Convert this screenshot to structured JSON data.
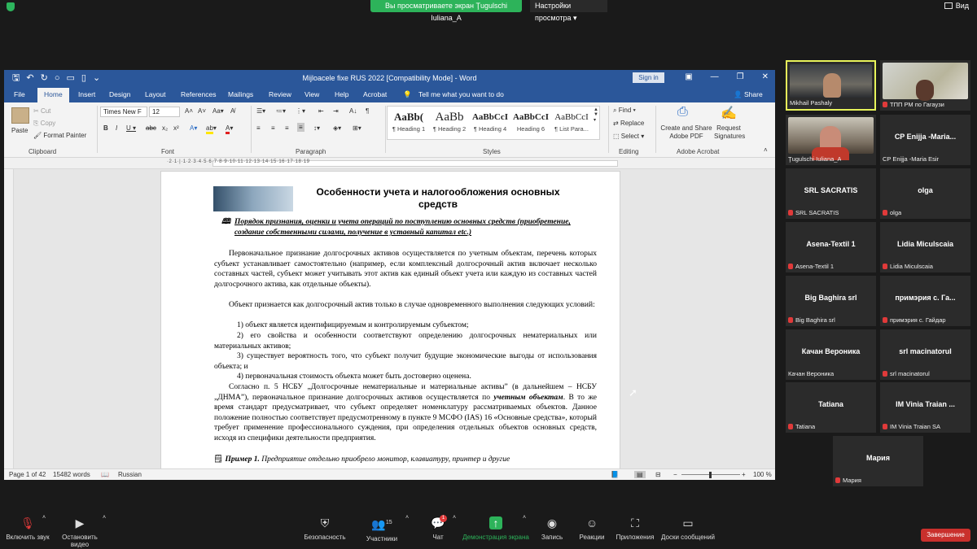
{
  "zoom_top": {
    "share_banner": "Вы просматриваете экран Ţugulschi Iuliana_A",
    "view_settings": "Настройки просмотра",
    "view_button": "Вид"
  },
  "word": {
    "window_title": "Mijloacele fixe RUS 2022 [Compatibility Mode] - Word",
    "sign_in": "Sign in",
    "tabs": [
      "File",
      "Home",
      "Insert",
      "Design",
      "Layout",
      "References",
      "Mailings",
      "Review",
      "View",
      "Help",
      "Acrobat"
    ],
    "tell_me": "Tell me what you want to do",
    "share": "Share",
    "ribbon": {
      "paste": "Paste",
      "cut": "Cut",
      "copy": "Copy",
      "format_painter": "Format Painter",
      "clipboard_label": "Clipboard",
      "font_name": "Times New F",
      "font_size": "12",
      "font_label": "Font",
      "paragraph_label": "Paragraph",
      "styles": [
        {
          "preview": "AaBb(",
          "name": "¶ Heading 1"
        },
        {
          "preview": "AaBb",
          "name": "¶ Heading 2"
        },
        {
          "preview": "AaBbCcI",
          "name": "¶ Heading 4"
        },
        {
          "preview": "AaBbCcI",
          "name": "Heading 6"
        },
        {
          "preview": "AaBbCcI",
          "name": "¶ List Para..."
        }
      ],
      "styles_label": "Styles",
      "find": "Find",
      "replace": "Replace",
      "select": "Select",
      "editing_label": "Editing",
      "create_pdf": "Create and Share Adobe PDF",
      "request_sig": "Request Signatures",
      "acrobat_label": "Adobe Acrobat"
    },
    "document": {
      "heading": "Особенности учета и налогообложения основных средств",
      "subheading": "Порядок признания, оценки и учета операций по поступлению основных средств (приобретение, создание собственными силами, получение в уставный капитал etc.)",
      "para1": "Первоначальное признание долгосрочных активов осуществляется по учетным объектам, перечень которых субъект устанавливает самостоятельно (например, если комплексный долгосрочный актив включает несколько составных частей, субъект может учитывать этот актив как единый объект учета или каждую из составных частей долгосрочного актива, как отдельные объекты).",
      "para2": "Объект признается как долгосрочный актив только в случае одновременного выполнения следующих условий:",
      "item1": "1)  объект является идентифицируемым и контролируемым субъектом;",
      "item2": "2)  его свойства и особенности соответствуют определению долгосрочных нематериальных или материальных активов;",
      "item3": "3)  существует вероятность того, что субъект получит будущие экономические выгоды от использования объекта; и",
      "item4": "4)  первоначальная стоимость объекта может быть достоверно оценена.",
      "para3a": "Согласно п. 5 НСБУ „Долгосрочные нематериальные и материальные активы” (в дальнейшем – НСБУ „ДНМА”), первоначальное признание долгосрочных активов осуществляется по ",
      "para3b": "учетным объектам",
      "para3c": ". В то же время стандарт предусматривает, что субъект определяет номенклатуру рассматриваемых объектов. Данное положение полностью соответствует предусмотренному в пункте 9 МСФО (IAS) 16 «Основные средства», который требует применение профессионального суждения, при определения отдельных объектов основных средств, исходя из специфики деятельности предприятия.",
      "example_label": "Пример 1.",
      "example_text": " Предприятие отдельно приобрело монитор, клавиатуру, принтер и другие"
    },
    "status": {
      "page": "Page 1 of 42",
      "words": "15482 words",
      "language": "Russian",
      "zoom": "100 %"
    }
  },
  "participants": [
    {
      "name": "Mikhail Pashaly",
      "label": "Mikhail Pashaly",
      "video": true,
      "active": true
    },
    {
      "name": "ТПП РМ по Гагаузии",
      "label": "ТПП РМ по Гагаузи",
      "video": true
    },
    {
      "name": "Ţugulschi Iuliana_A",
      "label": "Ţugulschi Iuliana_A",
      "video": true
    },
    {
      "name": "CP Enijja -Maria Esir",
      "label": "CP Enijja -Maria...",
      "foot": "CP Enijja -Maria Esir"
    },
    {
      "label": "SRL SACRATIS",
      "foot": "SRL SACRATIS"
    },
    {
      "label": "olga",
      "foot": "olga"
    },
    {
      "label": "Asena-Textil 1",
      "foot": "Asena-Textil 1"
    },
    {
      "label": "Lidia  Miculscaia",
      "foot": "Lidia  Miculscaia"
    },
    {
      "label": "Big Baghira srl",
      "foot": "Big Baghira srl"
    },
    {
      "label": "примэрия с. Га...",
      "foot": "примэрия с. Гайдар"
    },
    {
      "label": "Качан Вероника",
      "foot": "Качан Вероника"
    },
    {
      "label": "srl macinatorul",
      "foot": "srl macinatorul"
    },
    {
      "label": "Tatiana",
      "foot": "Tatiana"
    },
    {
      "label": "IM Vinia Traian ...",
      "foot": "IM Vinia Traian SA"
    },
    {
      "label": "Мария",
      "foot": "Мария"
    }
  ],
  "toolbar": {
    "mute": "Включить звук",
    "video": "Остановить видео",
    "security": "Безопасность",
    "participants": "Участники",
    "participants_count": "15",
    "chat": "Чат",
    "chat_badge": "1",
    "share": "Демонстрация экрана",
    "record": "Запись",
    "reactions": "Реакции",
    "apps": "Приложения",
    "whiteboard": "Доски сообщений",
    "end": "Завершение"
  }
}
